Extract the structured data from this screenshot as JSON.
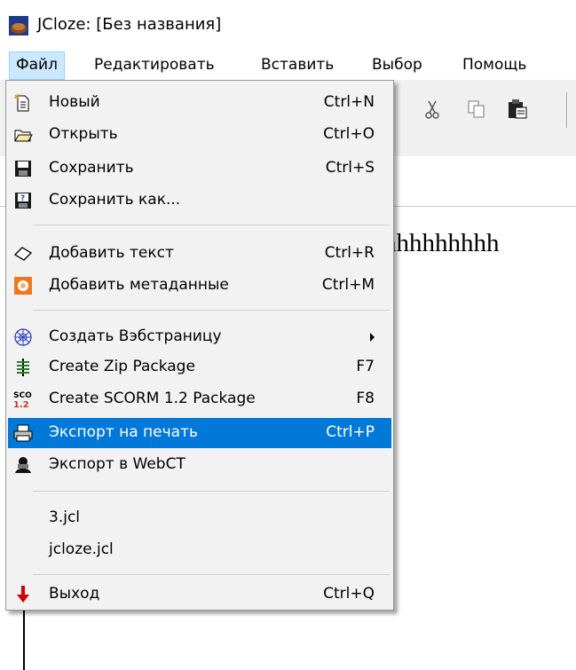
{
  "window": {
    "title": "JCloze: [Без названия]"
  },
  "menubar": [
    {
      "label": "Файл",
      "active": true
    },
    {
      "label": "Редактировать"
    },
    {
      "label": "Вставить"
    },
    {
      "label": "Выбор"
    },
    {
      "label": "Помощь"
    }
  ],
  "editor": {
    "text": "hhhhhhhhh"
  },
  "file_menu": {
    "items": [
      {
        "label": "Новый",
        "shortcut": "Ctrl+N",
        "icon": "new-document-icon"
      },
      {
        "label": "Открыть",
        "shortcut": "Ctrl+O",
        "icon": "open-folder-icon"
      },
      {
        "label": "Сохранить",
        "shortcut": "Ctrl+S",
        "icon": "save-disk-icon"
      },
      {
        "label": "Сохранить как...",
        "shortcut": "",
        "icon": "save-as-icon"
      },
      {
        "label": "Добавить текст",
        "shortcut": "Ctrl+R",
        "icon": "eraser-icon"
      },
      {
        "label": "Добавить метаданные",
        "shortcut": "Ctrl+M",
        "icon": "metadata-icon"
      },
      {
        "label": "Создать Вэбстраницу",
        "shortcut": "",
        "icon": "web-icon",
        "submenu": true
      },
      {
        "label": "Create Zip Package",
        "shortcut": "F7",
        "icon": "zip-icon"
      },
      {
        "label": "Create SCORM 1.2 Package",
        "shortcut": "F8",
        "icon": "scorm-icon"
      },
      {
        "label": "Экспорт на печать",
        "shortcut": "Ctrl+P",
        "icon": "print-icon",
        "highlighted": true
      },
      {
        "label": "Экспорт в WebCT",
        "shortcut": "",
        "icon": "webct-icon"
      },
      {
        "label": "3.jcl",
        "shortcut": ""
      },
      {
        "label": "jcloze.jcl",
        "shortcut": ""
      },
      {
        "label": "Выход",
        "shortcut": "Ctrl+Q",
        "icon": "exit-arrow-icon"
      }
    ],
    "scorm_icon_text": [
      "SCO",
      "1.2"
    ]
  },
  "colors": {
    "highlight": "#0078d7",
    "menu_bg": "#f2f2f2",
    "menubar_active": "#cce8ff"
  }
}
